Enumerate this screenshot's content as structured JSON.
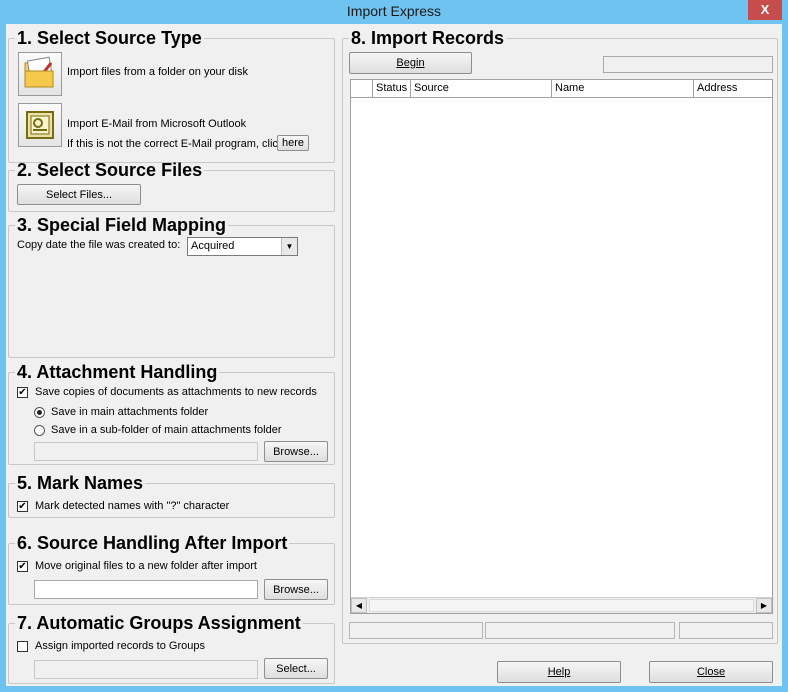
{
  "window": {
    "title": "Import Express",
    "close_glyph": "X"
  },
  "sections": {
    "s1": {
      "title": "1. Select Source Type",
      "folder_option": "Import files from a folder on your disk",
      "outlook_option": "Import E-Mail from Microsoft Outlook",
      "outlook_note": "If this is not the correct E-Mail program, click",
      "here_button": "here"
    },
    "s2": {
      "title": "2. Select Source Files",
      "select_files_button": "Select Files..."
    },
    "s3": {
      "title": "3. Special Field Mapping",
      "copy_date_label": "Copy date the file was created to:",
      "copy_date_value": "Acquired"
    },
    "s4": {
      "title": "4. Attachment Handling",
      "save_copies_label": "Save copies of documents as attachments to new records",
      "save_copies_checked": true,
      "radio_main": "Save in main attachments folder",
      "radio_sub": "Save in a sub-folder of main attachments folder",
      "browse_button": "Browse..."
    },
    "s5": {
      "title": "5. Mark Names",
      "mark_names_label": "Mark detected names with \"?\" character",
      "mark_names_checked": true
    },
    "s6": {
      "title": "6. Source Handling After Import",
      "move_label": "Move original files to a new folder after import",
      "move_checked": true,
      "browse_button": "Browse..."
    },
    "s7": {
      "title": "7. Automatic Groups Assignment",
      "assign_label": "Assign imported records to Groups",
      "assign_checked": false,
      "select_button": "Select..."
    },
    "s8": {
      "title": "8. Import Records",
      "begin_button": "Begin",
      "columns": [
        "Status",
        "Source",
        "Name",
        "Address"
      ]
    }
  },
  "footer": {
    "help_button": "Help",
    "close_button": "Close"
  },
  "icons": {
    "folder": "folder-import-icon",
    "outlook": "outlook-mail-icon"
  },
  "colors": {
    "titlebar": "#6fc3f0",
    "close": "#c74d4d",
    "dialog_bg": "#f0f0f0"
  }
}
